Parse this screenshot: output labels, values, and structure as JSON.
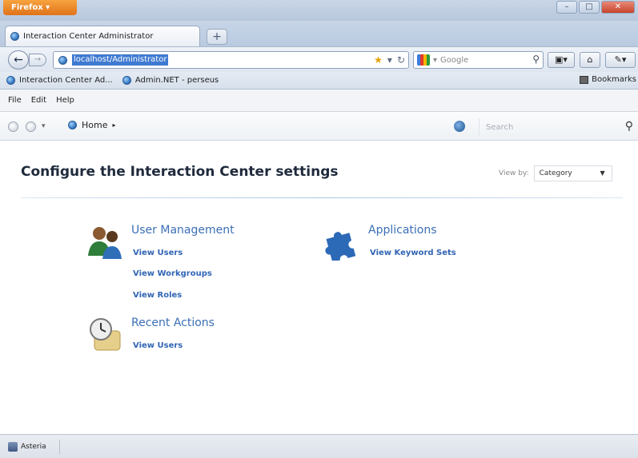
{
  "browser": {
    "menu_button": "Firefox",
    "tab_title": "Interaction Center Administrator",
    "new_tab": "+",
    "url": "localhost/Administrator",
    "search_placeholder": "Google",
    "bookmarks": [
      {
        "label": "Interaction Center Ad..."
      },
      {
        "label": "Admin.NET - perseus"
      }
    ],
    "bookmarks_menu": "Bookmarks"
  },
  "app": {
    "menu": [
      "File",
      "Edit",
      "Help"
    ],
    "breadcrumb": "Home",
    "search_placeholder": "Search",
    "page_title": "Configure the Interaction Center settings",
    "view_by_label": "View by:",
    "view_by_value": "Category",
    "groups": {
      "user_management": {
        "title": "User Management",
        "links": [
          "View Users",
          "View Workgroups",
          "View Roles"
        ]
      },
      "applications": {
        "title": "Applications",
        "links": [
          "View Keyword Sets"
        ]
      },
      "recent_actions": {
        "title": "Recent Actions",
        "links": [
          "View Users"
        ]
      }
    }
  },
  "status": {
    "server": "Asteria"
  },
  "colors": {
    "link": "#3165b4",
    "group_title": "#3b6fb5",
    "firefox_button": "#e0721a",
    "url_selection": "#3f7ad1"
  }
}
